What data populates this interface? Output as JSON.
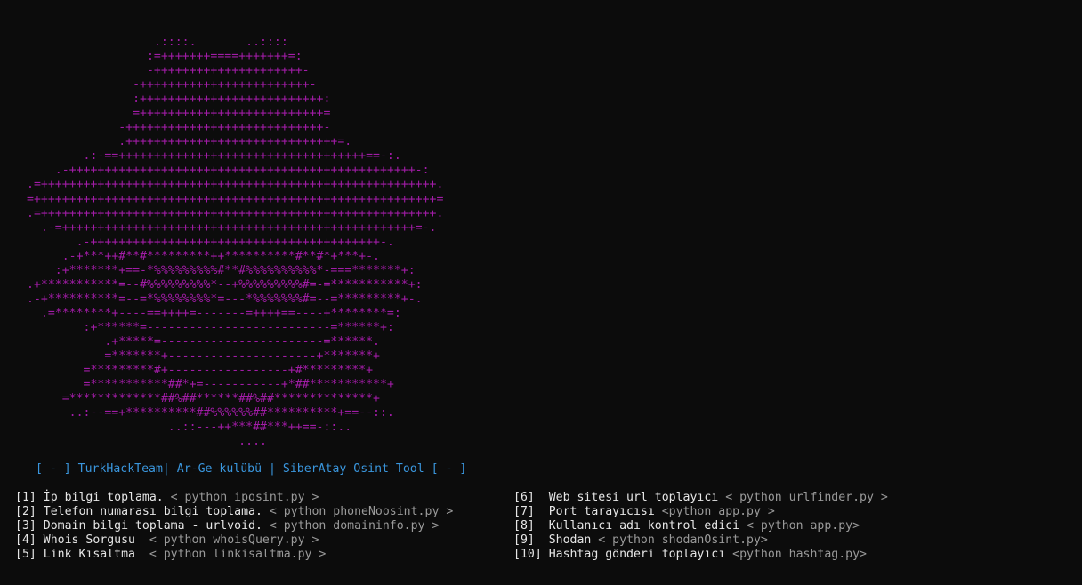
{
  "ascii_art": {
    "lines": [
      "                  .::::.       ..::::",
      "                 :=+++++++====+++++++=:",
      "                 -+++++++++++++++++++++-",
      "               -++++++++++++++++++++++++-",
      "               :++++++++++++++++++++++++++:",
      "               =++++++++++++++++++++++++++=",
      "             -++++++++++++++++++++++++++++-",
      "             .++++++++++++++++++++++++++++++=.",
      "        .:-==+++++++++++++++++++++++++++++++++++==-:.",
      "    .-+++++++++++++++++++++++++++++++++++++++++++++++++-:",
      ".=++++++++++++++++++++++++++++++++++++++++++++++++++++++++.",
      "=+++++++++++++++++++++++++++++++++++++++++++++++++++++++++=",
      ".=++++++++++++++++++++++++++++++++++++++++++++++++++++++++.",
      "  .-=++++++++++++++++++++++++++++++++++++++++++++++++++=-.",
      "       .-+++++++++++++++++++++++++++++++++++++++++-.",
      "     .-+***++#**#*********++**********#**#*+***+-.",
      "    :+*******+==-*%%%%%%%%%#**#%%%%%%%%%%*-===*******+:",
      ".+***********=--#%%%%%%%%%*--+%%%%%%%%%#=-=***********+:",
      ".-+**********=--=*%%%%%%%%*=---*%%%%%%%#=--=*********+-.",
      "  .=********+----==++++=-------=++++==----+********=:",
      "        :+******=--------------------------=******+:",
      "           .+*****=-----------------------=******.",
      "           =*******+---------------------+*******+",
      "        =*********#+-----------------+#*********+",
      "        =***********##*+=-----------+*##***********+",
      "     =*************##%##******##%##**************+",
      "      ..:--==+**********##%%%%%%##**********+==--::.",
      "                    ..::---++***##***++==-::..",
      "                              ...."
    ]
  },
  "banner": {
    "text": "[ - ] TurkHackTeam| Ar-Ge kulübü | SiberAtay Osint Tool [ - ]"
  },
  "menu": {
    "left": [
      {
        "label": "[1] İp bilgi toplama. ",
        "cmd": "< python iposint.py >"
      },
      {
        "label": "[2] Telefon numarası bilgi toplama. ",
        "cmd": "< python phoneNoosint.py >"
      },
      {
        "label": "[3] Domain bilgi toplama - urlvoid. ",
        "cmd": "< python domaininfo.py >"
      },
      {
        "label": "[4] Whois Sorgusu  ",
        "cmd": "< python whoisQuery.py >"
      },
      {
        "label": "[5] Link Kısaltma  ",
        "cmd": "< python linkisaltma.py >"
      }
    ],
    "right": [
      {
        "label": "[6]  Web sitesi url toplayıcı ",
        "cmd": "< python urlfinder.py >"
      },
      {
        "label": "[7]  Port tarayıcısı ",
        "cmd": "<python app.py >"
      },
      {
        "label": "[8]  Kullanıcı adı kontrol edici ",
        "cmd": "< python app.py>"
      },
      {
        "label": "[9]  Shodan ",
        "cmd": "< python shodanOsint.py>"
      },
      {
        "label": "[10] Hashtag gönderi toplayıcı ",
        "cmd": "<python hashtag.py>"
      }
    ]
  },
  "colors": {
    "background": "#0c0c0c",
    "ascii_magenta": "#a21ca7",
    "banner_blue": "#3a96dd",
    "label_text": "#e6e6e6",
    "command_text": "#9a9a9a"
  }
}
